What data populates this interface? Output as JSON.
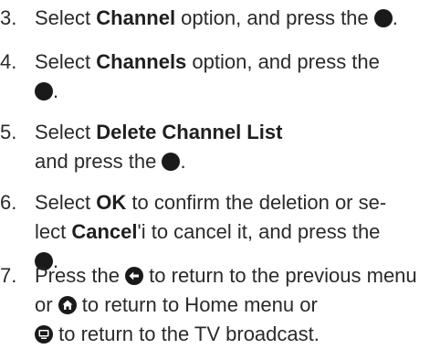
{
  "steps": [
    {
      "number": "3.",
      "t1": "Select ",
      "b1": "Channel",
      "t2": " option, and press the ",
      "t3": "."
    },
    {
      "number": "4.",
      "t1": "Select ",
      "b1": "Channels",
      "t2": " option, and press the",
      "t3": "."
    },
    {
      "number": "5.",
      "t1": "Select ",
      "b1": "Delete Channel List",
      "t2": " and press the ",
      "t3": "."
    },
    {
      "number": "6.",
      "t1": "Select ",
      "b1": "OK",
      "t2": " to confirm the deletion or se-lect ",
      "b2": "Cancel",
      "t3": "'i to cancel it, and press the",
      "t4": "."
    },
    {
      "number": "7.",
      "t1": "Press the ",
      "t2": " to return to the previous menu or ",
      "t3": " to return to Home menu or",
      "t4": " to return to the TV broadcast."
    }
  ],
  "icons": {
    "ok": "ok-button-icon",
    "back": "back-button-icon",
    "home": "home-button-icon",
    "tv": "tv-button-icon"
  }
}
